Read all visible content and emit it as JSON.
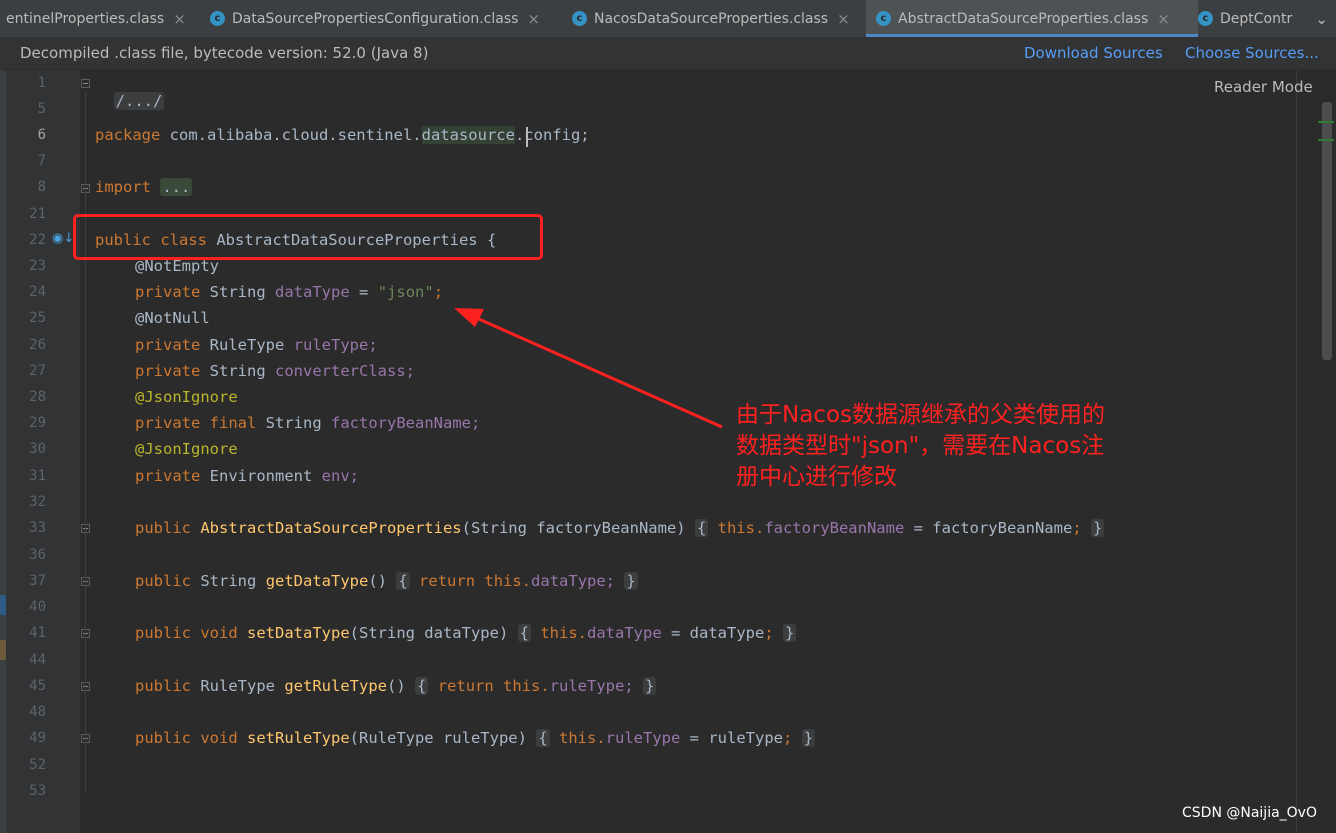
{
  "tabs": [
    {
      "label": "entinelProperties.class",
      "icon": "class-file-icon",
      "active": false
    },
    {
      "label": "DataSourcePropertiesConfiguration.class",
      "icon": "class-file-icon",
      "active": false
    },
    {
      "label": "NacosDataSourceProperties.class",
      "icon": "class-file-icon",
      "active": false
    },
    {
      "label": "AbstractDataSourceProperties.class",
      "icon": "class-file-icon",
      "active": true
    },
    {
      "label": "DeptContr",
      "icon": "class-file-icon",
      "active": false
    }
  ],
  "tab_close_glyph": "×",
  "class_icon_letter": "c",
  "banner": {
    "text": "Decompiled .class file, bytecode version: 52.0 (Java 8)",
    "download_sources": "Download Sources",
    "choose_sources": "Choose Sources..."
  },
  "editor": {
    "reader_mode": "Reader Mode",
    "line_numbers": [
      "1",
      "5",
      "6",
      "7",
      "8",
      "21",
      "22",
      "23",
      "24",
      "25",
      "26",
      "27",
      "28",
      "29",
      "30",
      "31",
      "32",
      "33",
      "36",
      "37",
      "40",
      "41",
      "44",
      "45",
      "48",
      "49",
      "52",
      "53"
    ],
    "code": {
      "l1": "/.../",
      "l6_kw": "package",
      "l6_a": "com.alibaba.cloud.sentinel.",
      "l6_b": "datasource",
      "l6_c": ".config;",
      "l8_kw": "import",
      "l8_fold": "...",
      "l22_kw": "public class",
      "l22_name": "AbstractDataSourceProperties {",
      "l23": "@NotEmpty",
      "l24_kw": "private",
      "l24_type": "String",
      "l24_field": "dataType",
      "l24_eq": "=",
      "l24_str": "\"json\"",
      "l24_semi": ";",
      "l25": "@NotNull",
      "l26_kw": "private",
      "l26_type": "RuleType",
      "l26_field": "ruleType;",
      "l27_kw": "private",
      "l27_type": "String",
      "l27_field": "converterClass;",
      "l28": "@JsonIgnore",
      "l29_kw": "private final",
      "l29_type": "String",
      "l29_field": "factoryBeanName;",
      "l30": "@JsonIgnore",
      "l31_kw": "private",
      "l31_type": "Environment",
      "l31_field": "env;",
      "l33_kw": "public",
      "l33_fn": "AbstractDataSourceProperties",
      "l33_params": "(String factoryBeanName)",
      "l33_ob": "{",
      "l33_this": "this.",
      "l33_field": "factoryBeanName",
      "l33_rest": "= factoryBeanName",
      "l33_semi": ";",
      "l33_cb": "}",
      "l37_kw": "public",
      "l37_type": "String",
      "l37_fn": "getDataType",
      "l37_params": "()",
      "l37_ob": "{",
      "l37_ret": "return this.",
      "l37_field": "dataType;",
      "l37_cb": "}",
      "l41_kw": "public void",
      "l41_fn": "setDataType",
      "l41_params": "(String dataType)",
      "l41_ob": "{",
      "l41_this": "this.",
      "l41_field": "dataType",
      "l41_rest": "= dataType",
      "l41_semi": ";",
      "l41_cb": "}",
      "l45_kw": "public",
      "l45_type": "RuleType",
      "l45_fn": "getRuleType",
      "l45_params": "()",
      "l45_ob": "{",
      "l45_ret": "return this.",
      "l45_field": "ruleType;",
      "l45_cb": "}",
      "l49_kw": "public void",
      "l49_fn": "setRuleType",
      "l49_params": "(RuleType ruleType)",
      "l49_ob": "{",
      "l49_this": "this.",
      "l49_field": "ruleType",
      "l49_rest": "= ruleType",
      "l49_semi": ";",
      "l49_cb": "}"
    }
  },
  "annotation": {
    "lines": [
      "由于Nacos数据源继承的父类使用的",
      "数据类型时\"json\"，需要在Nacos注",
      "册中心进行修改"
    ],
    "color": "#ff2020"
  },
  "watermark": "CSDN @Naijia_OvO",
  "colors": {
    "keyword": "#cc7832",
    "function": "#ffc66d",
    "field": "#9876aa",
    "string": "#6a8759",
    "annotation": "#bbb529",
    "text": "#a9b7c6",
    "link": "#589df6",
    "accent": "#4a88c7"
  }
}
